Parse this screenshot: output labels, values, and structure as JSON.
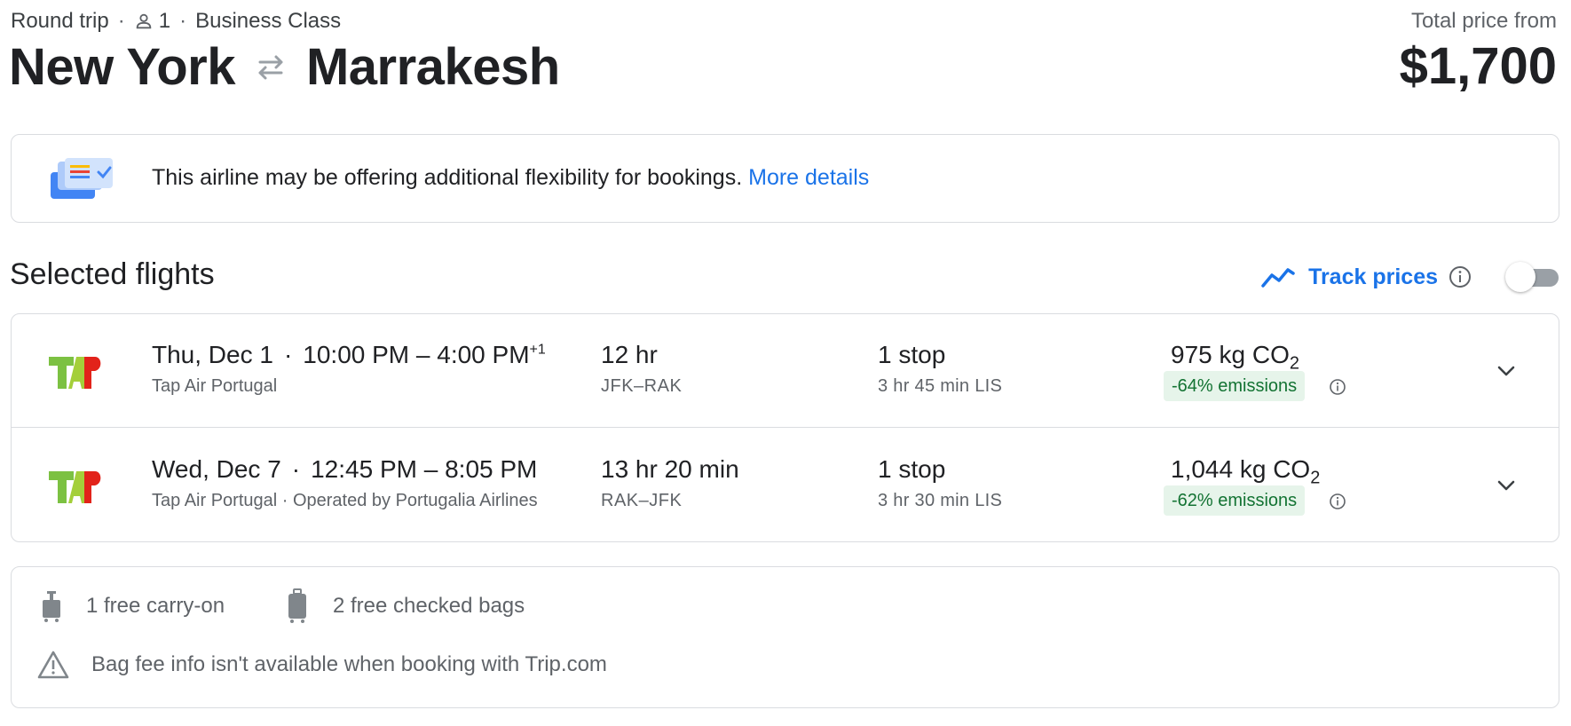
{
  "trip": {
    "type": "Round trip",
    "passengers": "1",
    "cabin": "Business Class",
    "origin": "New York",
    "destination": "Marrakesh"
  },
  "price": {
    "label": "Total price from",
    "amount": "$1,700"
  },
  "notice": {
    "text": "This airline may be offering additional flexibility for bookings.",
    "link": "More details"
  },
  "selected": {
    "title": "Selected flights",
    "track_label": "Track prices",
    "track_enabled": false
  },
  "flights": [
    {
      "date": "Thu, Dec 1",
      "time": "10:00 PM – 4:00 PM",
      "day_offset": "+1",
      "airline": "Tap Air Portugal",
      "duration": "12 hr",
      "airports": "JFK–RAK",
      "stops": "1 stop",
      "layover": "3 hr 45 min LIS",
      "co2_value": "975 kg CO",
      "co2_sub": "2",
      "emissions": "-64% emissions"
    },
    {
      "date": "Wed, Dec 7",
      "time": "12:45 PM – 8:05 PM",
      "day_offset": "",
      "airline": "Tap Air Portugal · Operated by Portugalia Airlines",
      "duration": "13 hr 20 min",
      "airports": "RAK–JFK",
      "stops": "1 stop",
      "layover": "3 hr 30 min LIS",
      "co2_value": "1,044 kg CO",
      "co2_sub": "2",
      "emissions": "-62% emissions"
    }
  ],
  "baggage": {
    "carry_on": "1 free carry-on",
    "checked": "2 free checked bags",
    "warning": "Bag fee info isn't available when booking with Trip.com"
  },
  "colors": {
    "accent": "#1a73e8",
    "emission_bg": "#e6f4ea",
    "emission_text": "#137333",
    "tap_green": "#7cc142",
    "tap_red": "#e2231a"
  },
  "icons": [
    "person-icon",
    "swap-arrows-icon",
    "flexibility-ticket-icon",
    "trend-line-icon",
    "info-icon",
    "tap-logo",
    "chevron-down-icon",
    "carry-on-bag-icon",
    "checked-bag-icon",
    "warning-icon"
  ]
}
